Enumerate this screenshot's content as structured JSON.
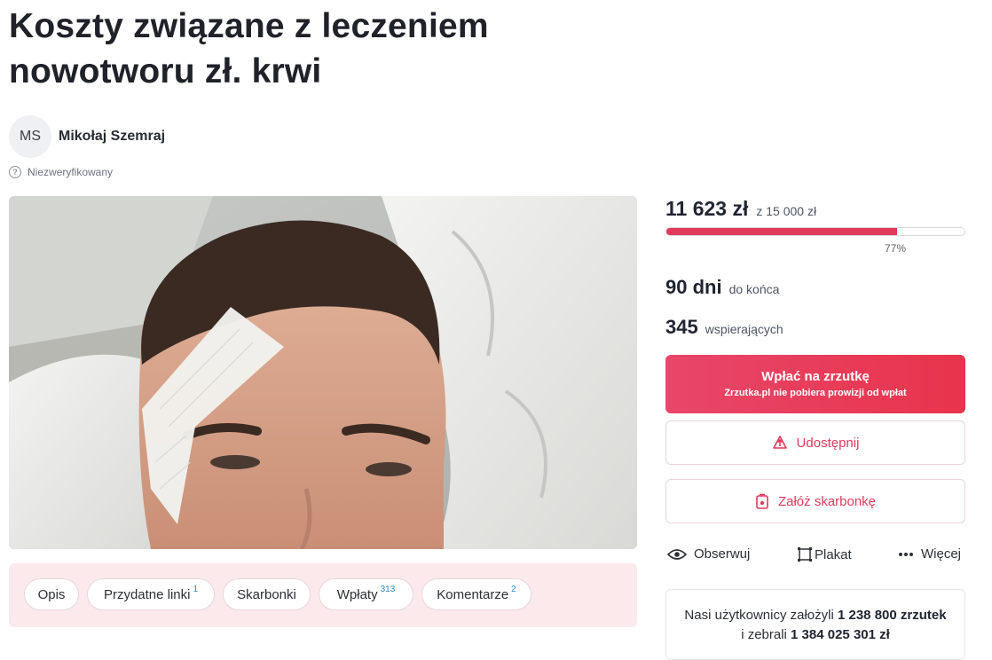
{
  "campaign": {
    "title_line1": "Koszty związane z leczeniem",
    "title_line2": "nowotworu zł. krwi"
  },
  "author": {
    "initials": "MS",
    "name": "Mikołaj Szemraj",
    "verification": "Niezweryfikowany",
    "verification_icon": "question-circle-icon"
  },
  "photo": {
    "icon": "photo"
  },
  "tabs": [
    {
      "label": "Opis",
      "badge": ""
    },
    {
      "label": "Przydatne linki",
      "badge": "1"
    },
    {
      "label": "Skarbonki",
      "badge": ""
    },
    {
      "label": "Wpłaty",
      "badge": "313"
    },
    {
      "label": "Komentarze",
      "badge": "2"
    }
  ],
  "funding": {
    "collected": "11 623 zł",
    "goal_text": "z 15 000 zł",
    "progress_percent_label": "77%",
    "progress_fraction": 0.775,
    "days_value": "90 dni",
    "days_label": "do końca",
    "supporters_value": "345",
    "supporters_label": "wspierających"
  },
  "buttons": {
    "donate_label": "Wpłać na zrzutkę",
    "donate_sub": "Zrzutka.pl nie pobiera prowizji od wpłat",
    "share_label": "Udostępnij",
    "piggybank_label": "Załóż skarbonkę"
  },
  "actions": {
    "follow_label": "Obserwuj",
    "poster_label": "Plakat",
    "more_label": "Więcej"
  },
  "info": {
    "line1_prefix": "Nasi użytkownicy założyli",
    "campaign_count": "1 238 800 zrzutek",
    "line2_prefix": "i zebrali",
    "total_raised": "1 384 025 301 zł"
  },
  "colors": {
    "accent": "#e0395b",
    "tabs_background": "#fbe9ec",
    "badge_color": "#2a8ac9"
  }
}
